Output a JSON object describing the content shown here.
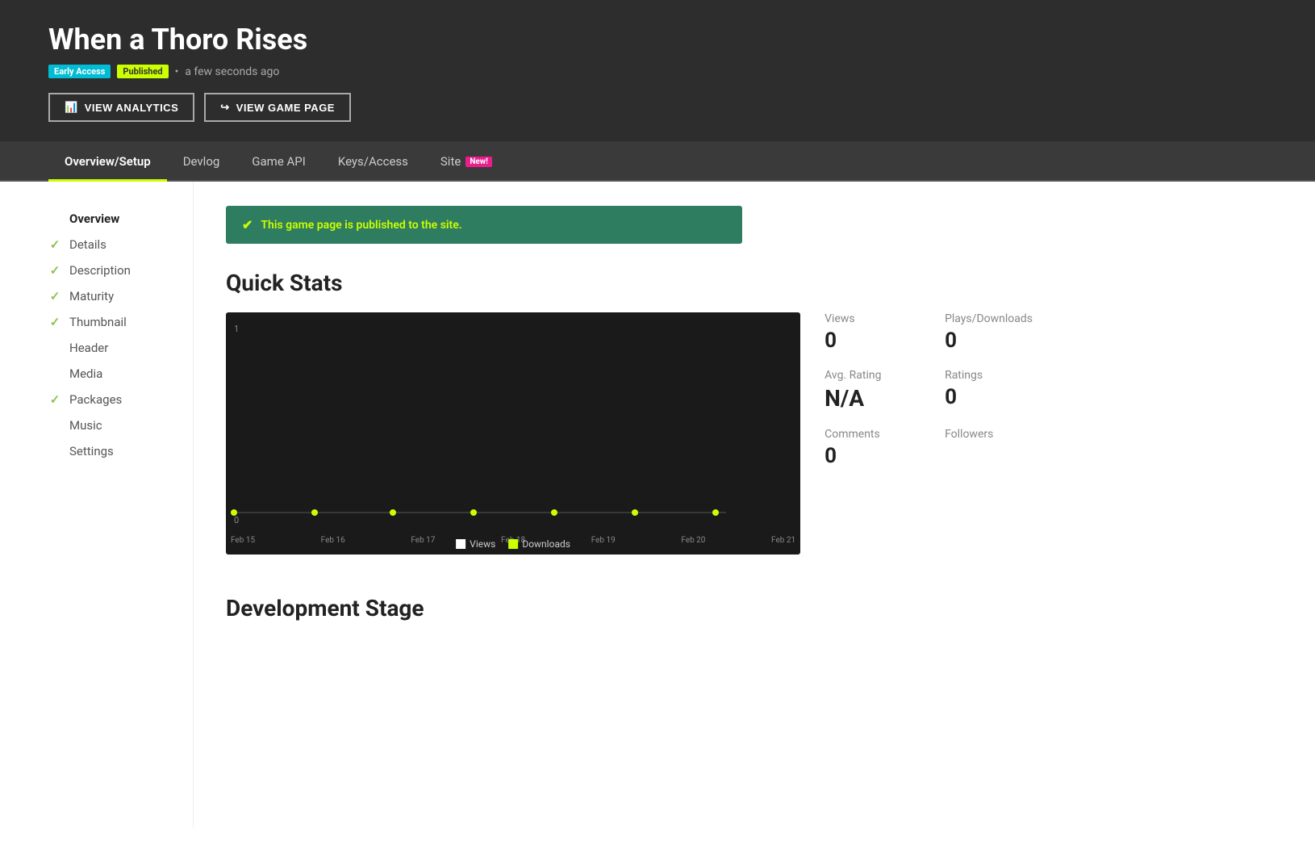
{
  "header": {
    "title": "When a Thoro Rises",
    "badge_early_access": "Early Access",
    "badge_published": "Published",
    "time_ago": "a few seconds ago",
    "btn_analytics": "VIEW ANALYTICS",
    "btn_game_page": "VIEW GAME PAGE"
  },
  "nav": {
    "tabs": [
      {
        "id": "overview-setup",
        "label": "Overview/Setup",
        "active": true,
        "new_badge": false
      },
      {
        "id": "devlog",
        "label": "Devlog",
        "active": false,
        "new_badge": false
      },
      {
        "id": "game-api",
        "label": "Game API",
        "active": false,
        "new_badge": false
      },
      {
        "id": "keys-access",
        "label": "Keys/Access",
        "active": false,
        "new_badge": false
      },
      {
        "id": "site",
        "label": "Site",
        "active": false,
        "new_badge": true
      }
    ],
    "new_badge_text": "New!"
  },
  "sidebar": {
    "items": [
      {
        "id": "overview",
        "label": "Overview",
        "checked": false,
        "active": true
      },
      {
        "id": "details",
        "label": "Details",
        "checked": true
      },
      {
        "id": "description",
        "label": "Description",
        "checked": true
      },
      {
        "id": "maturity",
        "label": "Maturity",
        "checked": true
      },
      {
        "id": "thumbnail",
        "label": "Thumbnail",
        "checked": true
      },
      {
        "id": "header",
        "label": "Header",
        "checked": false
      },
      {
        "id": "media",
        "label": "Media",
        "checked": false
      },
      {
        "id": "packages",
        "label": "Packages",
        "checked": true
      },
      {
        "id": "music",
        "label": "Music",
        "checked": false
      },
      {
        "id": "settings",
        "label": "Settings",
        "checked": false
      }
    ]
  },
  "alert": {
    "message": "This game page is published to the site."
  },
  "quick_stats": {
    "section_title": "Quick Stats",
    "stats": [
      {
        "id": "views",
        "label": "Views",
        "value": "0"
      },
      {
        "id": "plays-downloads",
        "label": "Plays/Downloads",
        "value": "0"
      },
      {
        "id": "avg-rating",
        "label": "Avg. Rating",
        "value": "N/A"
      },
      {
        "id": "ratings",
        "label": "Ratings",
        "value": "0"
      },
      {
        "id": "comments",
        "label": "Comments",
        "value": "0"
      },
      {
        "id": "followers",
        "label": "Followers",
        "value": ""
      }
    ],
    "chart": {
      "y_label": "1",
      "y_zero": "0",
      "x_labels": [
        "Feb 15",
        "Feb 16",
        "Feb 17",
        "Feb 18",
        "Feb 19",
        "Feb 20",
        "Feb 21"
      ],
      "legend_views": "Views",
      "legend_downloads": "Downloads"
    }
  },
  "development_stage": {
    "section_title": "Development Stage"
  }
}
